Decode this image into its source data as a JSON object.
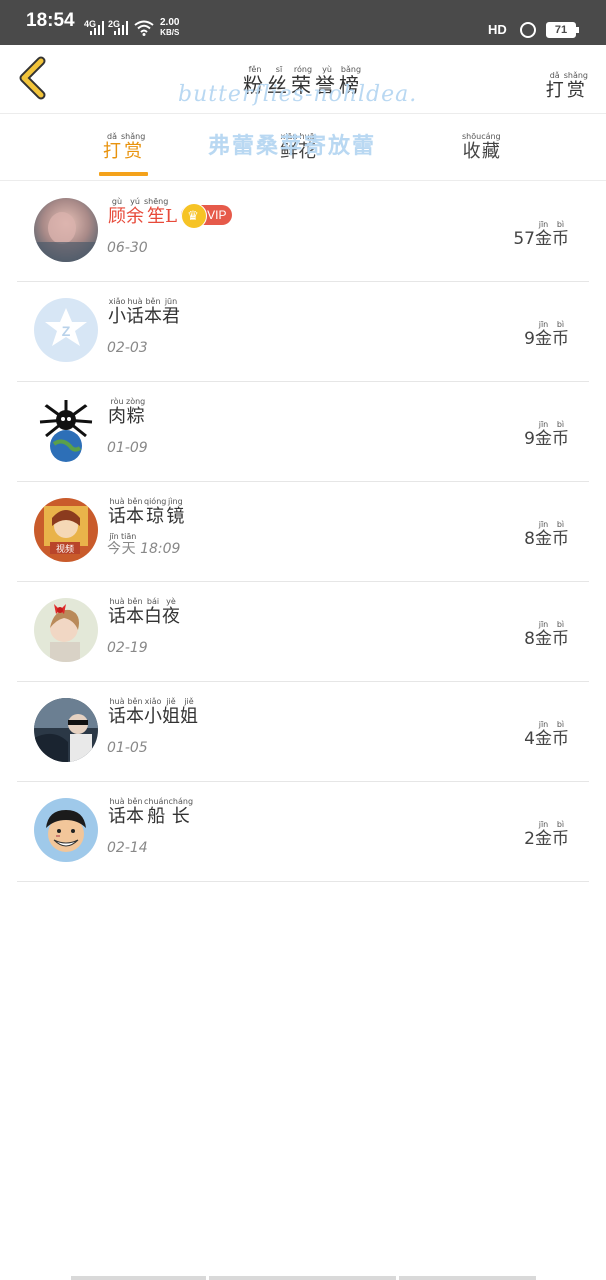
{
  "status_bar": {
    "time": "18:54",
    "net1": "4G",
    "net2": "2G",
    "speed_value": "2.00",
    "speed_unit": "KB/S",
    "hd": "HD",
    "battery": "71"
  },
  "header": {
    "title": [
      {
        "hz": "粉",
        "py": "fěn"
      },
      {
        "hz": "丝",
        "py": "sī"
      },
      {
        "hz": "荣",
        "py": "róng"
      },
      {
        "hz": "誉",
        "py": "yù"
      },
      {
        "hz": "榜",
        "py": "bǎng"
      }
    ],
    "watermark": "butterflies-nohldea.",
    "reward_button": [
      {
        "hz": "打",
        "py": "dǎ"
      },
      {
        "hz": "赏",
        "py": "shǎng"
      }
    ]
  },
  "tabs": [
    {
      "chars": [
        {
          "hz": "打",
          "py": "dǎ"
        },
        {
          "hz": "赏",
          "py": "shǎng"
        }
      ],
      "active": true
    },
    {
      "chars": [
        {
          "hz": "鲜",
          "py": "xiān"
        },
        {
          "hz": "花",
          "py": "huā"
        }
      ],
      "active": false
    },
    {
      "chars": [
        {
          "hz": "收",
          "py": "shōu"
        },
        {
          "hz": "藏",
          "py": "cáng"
        }
      ],
      "active": false
    }
  ],
  "tab_watermark": "弗蕾桑苹寄放蕾",
  "coin_unit": [
    {
      "hz": "金",
      "py": "jīn"
    },
    {
      "hz": "币",
      "py": "bì"
    }
  ],
  "fans": [
    {
      "name": [
        {
          "hz": "顾",
          "py": "gù"
        },
        {
          "hz": "余",
          "py": "yú"
        },
        {
          "hz": "笙",
          "py": "shēng"
        },
        {
          "hz": "L",
          "py": ""
        }
      ],
      "vip": true,
      "vip_label": "VIP",
      "date": "06-30",
      "coins": "57",
      "avatar": "blurred-person"
    },
    {
      "name": [
        {
          "hz": "小",
          "py": "xiǎo"
        },
        {
          "hz": "话",
          "py": "huà"
        },
        {
          "hz": "本",
          "py": "běn"
        },
        {
          "hz": "君",
          "py": "jūn"
        }
      ],
      "vip": false,
      "date": "02-03",
      "coins": "9",
      "avatar": "default-z"
    },
    {
      "name": [
        {
          "hz": "肉",
          "py": "ròu"
        },
        {
          "hz": "粽",
          "py": "zòng"
        }
      ],
      "vip": false,
      "date": "01-09",
      "coins": "9",
      "avatar": "spider-earth"
    },
    {
      "name": [
        {
          "hz": "话",
          "py": "huà"
        },
        {
          "hz": "本",
          "py": "běn"
        },
        {
          "hz": "琼",
          "py": "qióng"
        },
        {
          "hz": "镜",
          "py": "jìng"
        }
      ],
      "vip": false,
      "date": "今天 18:09",
      "date_chars": [
        {
          "hz": "今",
          "py": "jīn"
        },
        {
          "hz": "天",
          "py": "tiān"
        }
      ],
      "date_time": "18:09",
      "coins": "8",
      "avatar": "anime-gold"
    },
    {
      "name": [
        {
          "hz": "话",
          "py": "huà"
        },
        {
          "hz": "本",
          "py": "běn"
        },
        {
          "hz": "白",
          "py": "bái"
        },
        {
          "hz": "夜",
          "py": "yè"
        }
      ],
      "vip": false,
      "date": "02-19",
      "coins": "8",
      "avatar": "girl-red-bow"
    },
    {
      "name": [
        {
          "hz": "话",
          "py": "huà"
        },
        {
          "hz": "本",
          "py": "běn"
        },
        {
          "hz": "小",
          "py": "xiǎo"
        },
        {
          "hz": "姐",
          "py": "jiě"
        },
        {
          "hz": "姐",
          "py": "jiě"
        }
      ],
      "vip": false,
      "date": "01-05",
      "coins": "4",
      "avatar": "car-photo"
    },
    {
      "name": [
        {
          "hz": "话",
          "py": "huà"
        },
        {
          "hz": "本",
          "py": "běn"
        },
        {
          "hz": "船",
          "py": "chuán"
        },
        {
          "hz": "长",
          "py": "cháng"
        }
      ],
      "vip": false,
      "date": "02-14",
      "coins": "2",
      "avatar": "luffy"
    }
  ],
  "colors": {
    "accent": "#e8930e",
    "vip_name": "#e74a3a",
    "status_bar": "#4a4a4a",
    "back_arrow": "#f2c43a"
  }
}
